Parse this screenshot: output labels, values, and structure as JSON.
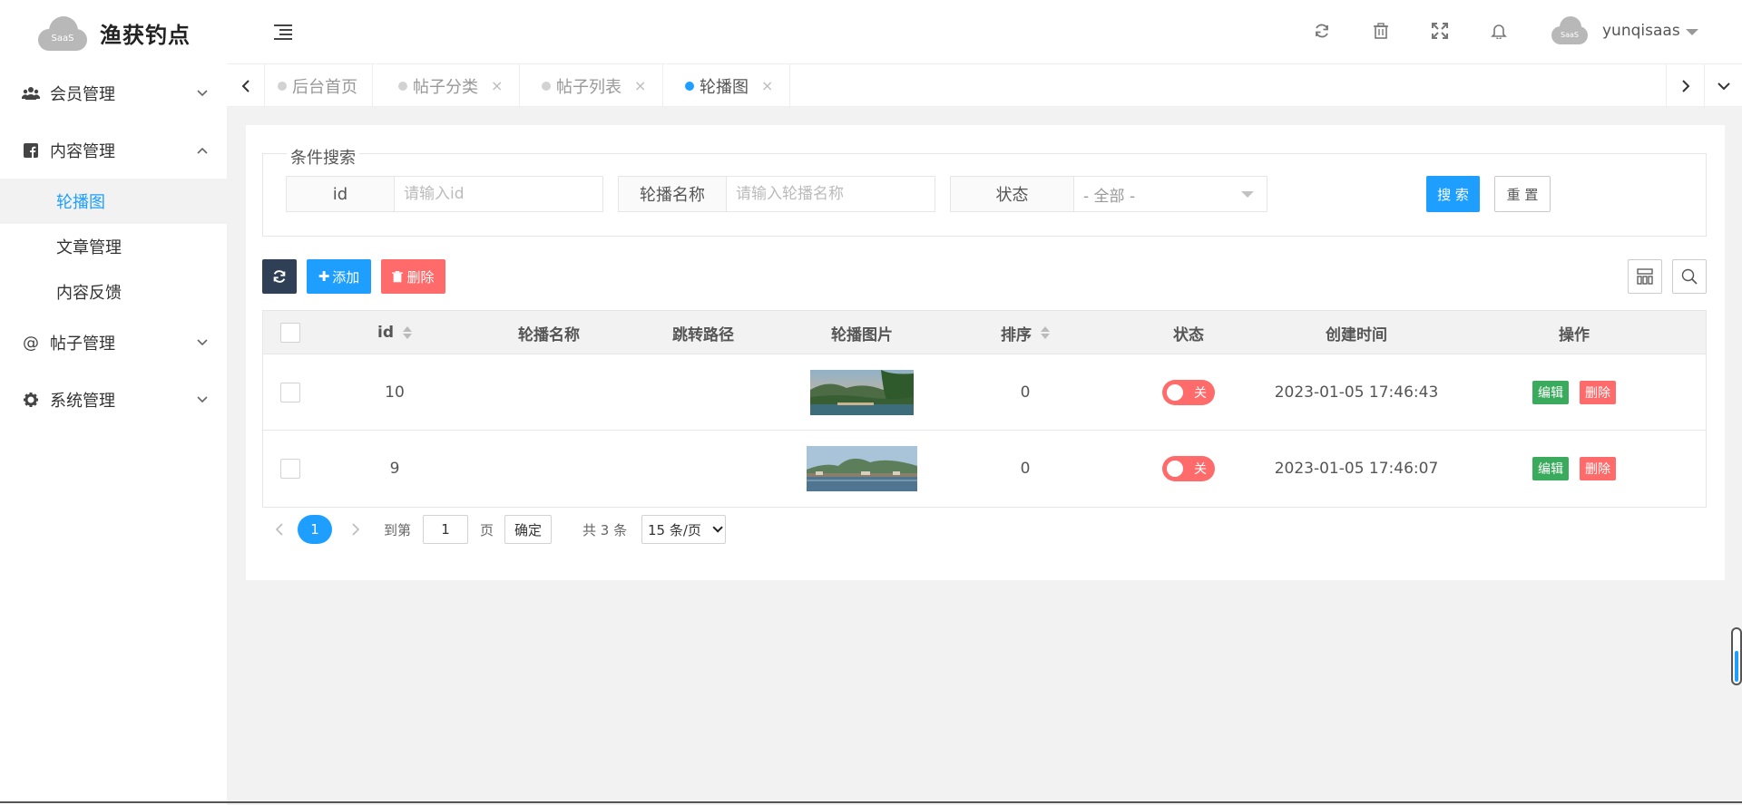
{
  "app": {
    "logo_badge": "SaaS",
    "title": "渔获钓点",
    "username": "yunqisaas",
    "avatar_badge": "SaaS"
  },
  "header_icons": [
    "refresh-icon",
    "trash-icon",
    "fullscreen-icon",
    "bell-icon"
  ],
  "sidebar": {
    "groups": [
      {
        "label": "会员管理",
        "icon": "users-icon",
        "expanded": false
      },
      {
        "label": "内容管理",
        "icon": "facebook-square-icon",
        "expanded": true
      },
      {
        "label": "帖子管理",
        "icon": "at-icon",
        "expanded": false
      },
      {
        "label": "系统管理",
        "icon": "gear-icon",
        "expanded": false
      }
    ],
    "sub_items": [
      {
        "label": "轮播图",
        "active": true
      },
      {
        "label": "文章管理",
        "active": false
      },
      {
        "label": "内容反馈",
        "active": false
      }
    ]
  },
  "tabs": [
    {
      "label": "后台首页",
      "closable": false,
      "active": false
    },
    {
      "label": "帖子分类",
      "closable": true,
      "active": false
    },
    {
      "label": "帖子列表",
      "closable": true,
      "active": false
    },
    {
      "label": "轮播图",
      "closable": true,
      "active": true
    }
  ],
  "search": {
    "legend": "条件搜索",
    "id_label": "id",
    "id_placeholder": "请输入id",
    "name_label": "轮播名称",
    "name_placeholder": "请输入轮播名称",
    "status_label": "状态",
    "status_value": "- 全部 -",
    "search_button": "搜 索",
    "reset_button": "重 置"
  },
  "toolbar": {
    "add_label": "添加",
    "delete_label": "删除"
  },
  "table": {
    "columns": [
      "id",
      "轮播名称",
      "跳转路径",
      "轮播图片",
      "排序",
      "状态",
      "创建时间",
      "操作"
    ],
    "rows": [
      {
        "id": "10",
        "name": "",
        "path": "",
        "image": "landscape-thumbnail",
        "sort": "0",
        "status": "关",
        "created": "2023-01-05 17:46:43",
        "edit": "编辑",
        "delete": "删除"
      },
      {
        "id": "9",
        "name": "",
        "path": "",
        "image": "lake-thumbnail",
        "sort": "0",
        "status": "关",
        "created": "2023-01-05 17:46:07",
        "edit": "编辑",
        "delete": "删除"
      }
    ]
  },
  "pagination": {
    "current_page": "1",
    "goto_label": "到第",
    "goto_value": "1",
    "page_unit": "页",
    "confirm": "确定",
    "total": "共 3 条",
    "page_size": "15 条/页"
  },
  "colors": {
    "primary": "#1e9fff",
    "danger": "#ff6b6b",
    "success": "#3aaa5d",
    "dark": "#2f4056"
  }
}
